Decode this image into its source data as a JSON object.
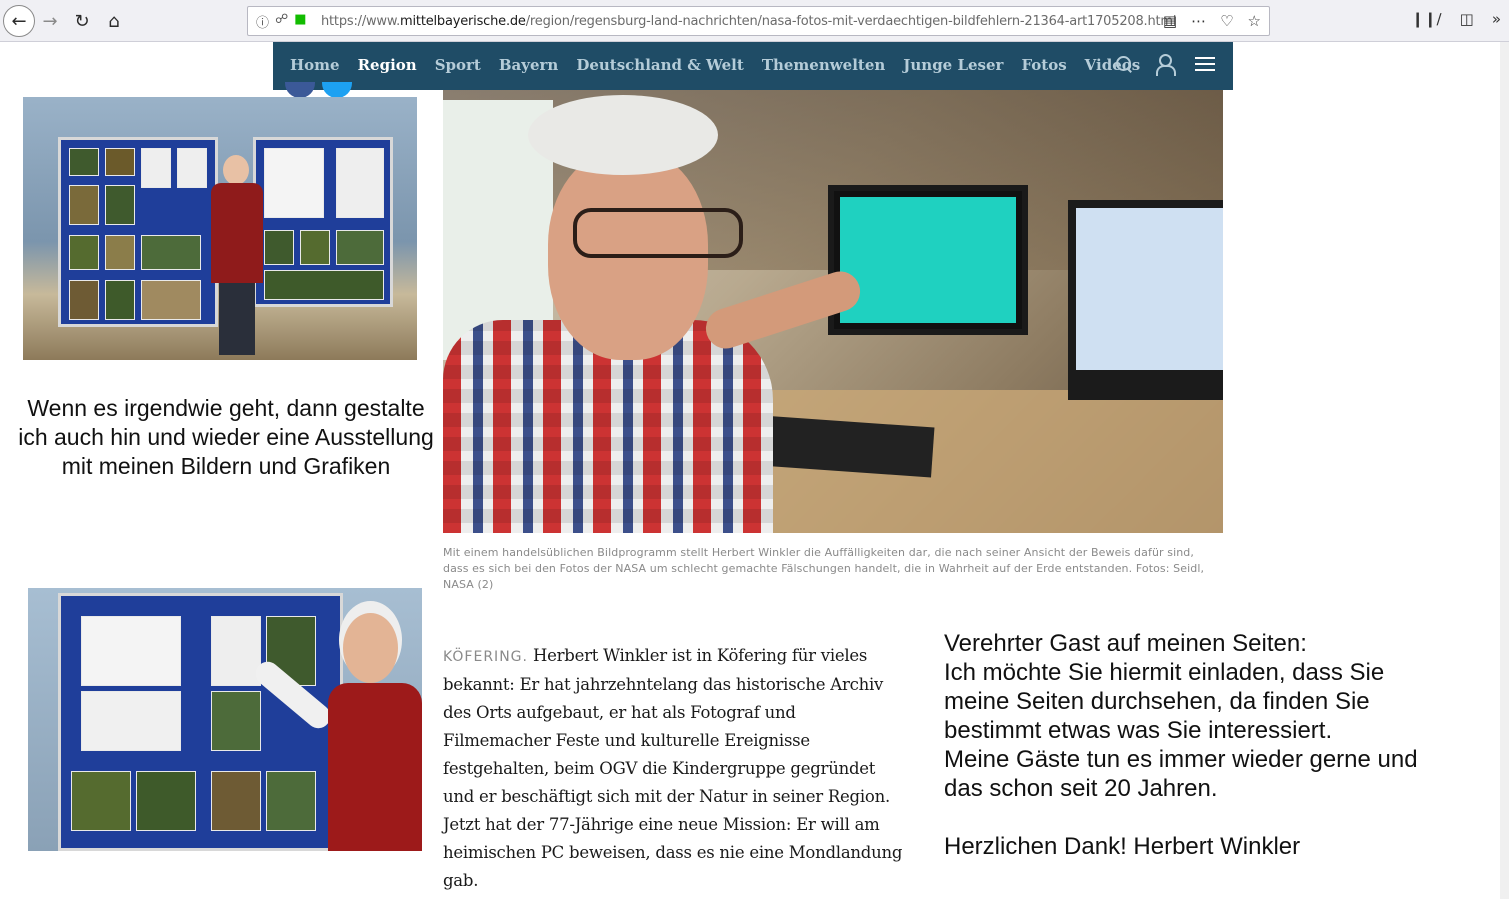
{
  "browser": {
    "url_prefix": "https://www.",
    "url_domain": "mittelbayerische.de",
    "url_path": "/region/regensburg-land-nachrichten/nasa-fotos-mit-verdaechtigen-bildfehlern-21364-art1705208.html",
    "icons": [
      "back-icon",
      "forward-icon",
      "reload-icon",
      "home-icon",
      "info-icon",
      "shield-icon",
      "lock-icon",
      "reader-icon",
      "more-icon",
      "pocket-icon",
      "bookmark-star-icon",
      "library-icon",
      "sidebar-icon",
      "overflow-icon"
    ]
  },
  "site_nav": {
    "items": [
      {
        "label": "Home"
      },
      {
        "label": "Region",
        "active": true
      },
      {
        "label": "Sport"
      },
      {
        "label": "Bayern"
      },
      {
        "label": "Deutschland & Welt"
      },
      {
        "label": "Themenwelten"
      },
      {
        "label": "Junge Leser"
      },
      {
        "label": "Fotos"
      },
      {
        "label": "Videos"
      }
    ],
    "bg_color": "#1f4c66",
    "text_color": "#b5ccd8"
  },
  "quote_left": "Wenn es irgendwie geht, dann gestalte ich auch hin und wieder eine Ausstellung mit meinen Bildern und Grafiken",
  "caption": "Mit einem handelsüblichen Bildprogramm stellt Herbert Winkler die Auffälligkeiten dar, die nach seiner Ansicht der Beweis dafür sind, dass es sich bei den Fotos der NASA um schlecht gemachte Fälschungen handelt, die in Wahrheit auf der Erde entstanden. Fotos: Seidl, NASA (2)",
  "article": {
    "dateline": "KÖFERING.",
    "body": "Herbert Winkler ist in Köfering für vieles bekannt: Er hat jahrzehntelang das historische Archiv des Orts aufgebaut, er hat als Fotograf und Filmemacher Feste und kulturelle Ereignisse festgehalten, beim OGV die Kindergruppe gegründet und er beschäftigt sich mit der Natur in seiner Region. Jetzt hat der 77-Jährige eine neue Mission: Er will am heimischen PC beweisen, dass es nie eine Mondlandung gab."
  },
  "greeting": {
    "line1": "Verehrter Gast auf meinen Seiten:",
    "line2": "Ich möchte Sie hiermit einladen, dass Sie meine Seiten durchsehen, da finden Sie bestimmt etwas was Sie interessiert.",
    "line3": "Meine Gäste tun es immer wieder gerne und das schon seit 20 Jahren.",
    "line4": "Herzlichen Dank! Herbert Winkler"
  }
}
